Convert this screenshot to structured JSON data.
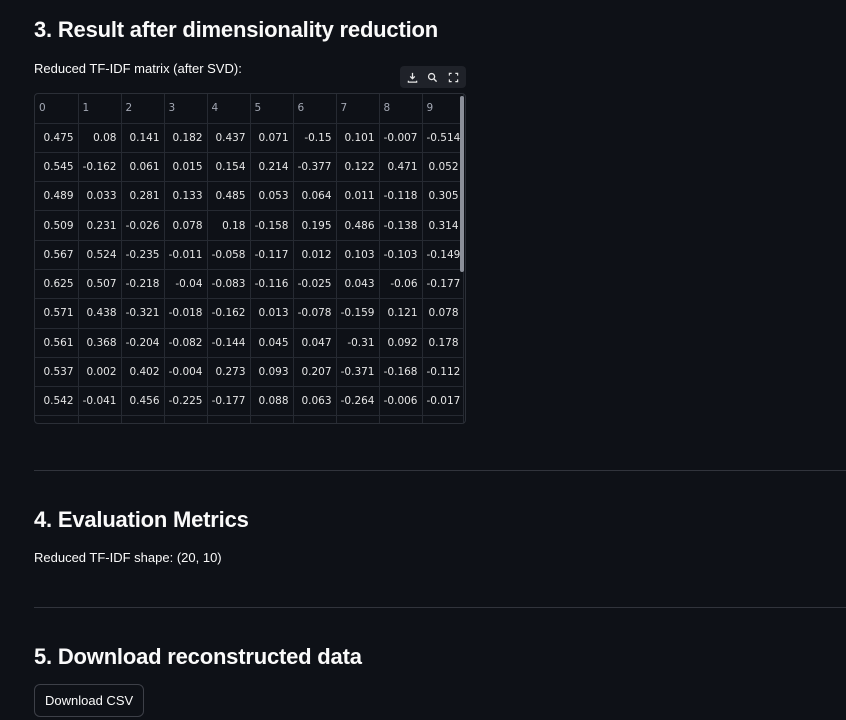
{
  "section3": {
    "title": "3. Result after dimensionality reduction",
    "caption": "Reduced TF-IDF matrix (after SVD):"
  },
  "toolbar": {
    "icons": [
      "download-icon",
      "search-icon",
      "fullscreen-icon"
    ]
  },
  "table": {
    "columns": [
      "0",
      "1",
      "2",
      "3",
      "4",
      "5",
      "6",
      "7",
      "8",
      "9"
    ],
    "rows": [
      [
        "0.475",
        "0.08",
        "0.141",
        "0.182",
        "0.437",
        "0.071",
        "-0.15",
        "0.101",
        "-0.007",
        "-0.514"
      ],
      [
        "0.545",
        "-0.162",
        "0.061",
        "0.015",
        "0.154",
        "0.214",
        "-0.377",
        "0.122",
        "0.471",
        "0.052"
      ],
      [
        "0.489",
        "0.033",
        "0.281",
        "0.133",
        "0.485",
        "0.053",
        "0.064",
        "0.011",
        "-0.118",
        "0.305"
      ],
      [
        "0.509",
        "0.231",
        "-0.026",
        "0.078",
        "0.18",
        "-0.158",
        "0.195",
        "0.486",
        "-0.138",
        "0.314"
      ],
      [
        "0.567",
        "0.524",
        "-0.235",
        "-0.011",
        "-0.058",
        "-0.117",
        "0.012",
        "0.103",
        "-0.103",
        "-0.149"
      ],
      [
        "0.625",
        "0.507",
        "-0.218",
        "-0.04",
        "-0.083",
        "-0.116",
        "-0.025",
        "0.043",
        "-0.06",
        "-0.177"
      ],
      [
        "0.571",
        "0.438",
        "-0.321",
        "-0.018",
        "-0.162",
        "0.013",
        "-0.078",
        "-0.159",
        "0.121",
        "0.078"
      ],
      [
        "0.561",
        "0.368",
        "-0.204",
        "-0.082",
        "-0.144",
        "0.045",
        "0.047",
        "-0.31",
        "0.092",
        "0.178"
      ],
      [
        "0.537",
        "0.002",
        "0.402",
        "-0.004",
        "0.273",
        "0.093",
        "0.207",
        "-0.371",
        "-0.168",
        "-0.112"
      ],
      [
        "0.542",
        "-0.041",
        "0.456",
        "-0.225",
        "-0.177",
        "0.088",
        "0.063",
        "-0.264",
        "-0.006",
        "-0.017"
      ]
    ]
  },
  "section4": {
    "title": "4. Evaluation Metrics",
    "caption": "Reduced TF-IDF shape: (20, 10)"
  },
  "section5": {
    "title": "5. Download reconstructed data",
    "button_label": "Download CSV"
  },
  "colors": {
    "background": "#0e1117",
    "text": "#fafafa",
    "grid": "#262a32"
  }
}
